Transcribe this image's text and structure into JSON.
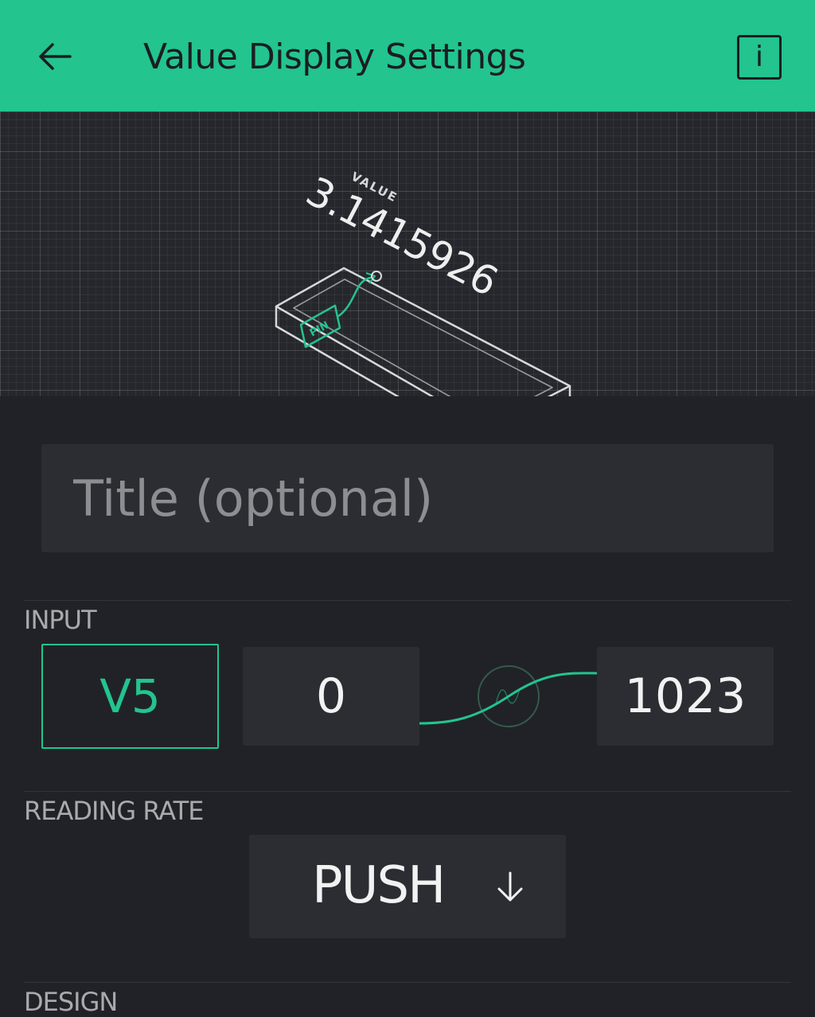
{
  "header": {
    "title": "Value Display Settings",
    "back_icon": "arrow-left-icon",
    "info_label": "i",
    "background": "#23c48e"
  },
  "illustration": {
    "widget_label": "VALUE",
    "widget_value": "3.1415926",
    "pin_label": "PIN"
  },
  "title_field": {
    "placeholder": "Title (optional)",
    "value": ""
  },
  "input": {
    "section_label": "INPUT",
    "pin": "V5",
    "min": "0",
    "max": "1023",
    "mapping_icon": "wave-icon"
  },
  "reading_rate": {
    "section_label": "READING RATE",
    "selected": "PUSH",
    "dropdown_icon": "arrow-down-icon"
  },
  "design": {
    "section_label": "DESIGN"
  },
  "colors": {
    "accent": "#23c48e",
    "background": "#212227",
    "field": "#2c2d32"
  }
}
